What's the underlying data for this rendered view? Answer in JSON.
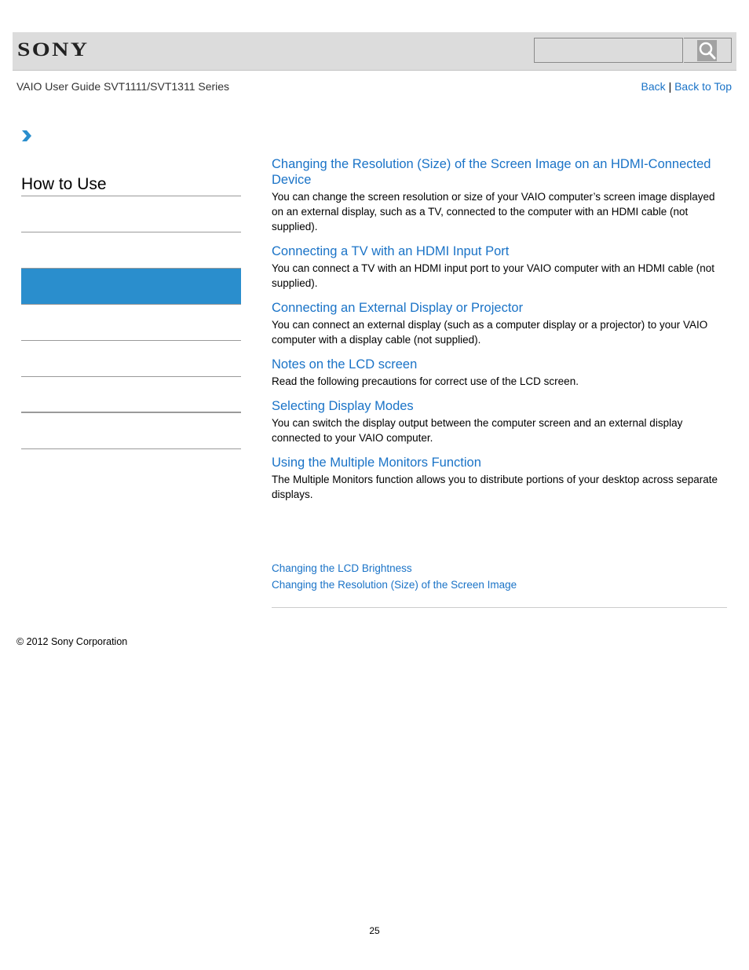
{
  "header": {
    "logo": "SONY",
    "search": {
      "placeholder": "",
      "value": "",
      "button_icon": "search-icon"
    }
  },
  "subheader": {
    "guide_title": "VAIO User Guide SVT1111/SVT1311 Series",
    "back_label": "Back",
    "separator": "|",
    "back_to_top_label": "Back to Top"
  },
  "breadcrumb": {
    "icon": "chevron-right-icon"
  },
  "sidebar": {
    "title": "How to Use",
    "items": [
      {
        "label": "",
        "active": false
      },
      {
        "label": "",
        "active": false
      },
      {
        "label": "",
        "active": true
      },
      {
        "label": "",
        "active": false
      },
      {
        "label": "",
        "active": false
      },
      {
        "label": "",
        "active": false
      },
      {
        "label": "",
        "active": false
      },
      {
        "label": "",
        "active": false
      }
    ]
  },
  "entries": [
    {
      "title": "Changing the Resolution (Size) of the Screen Image on an HDMI-Connected Device",
      "description": "You can change the screen resolution or size of your VAIO computer’s screen image displayed on an external display, such as a TV, connected to the computer with an HDMI cable (not supplied)."
    },
    {
      "title": "Connecting a TV with an HDMI Input Port",
      "description": "You can connect a TV with an HDMI input port to your VAIO computer with an HDMI cable (not supplied)."
    },
    {
      "title": "Connecting an External Display or Projector",
      "description": "You can connect an external display (such as a computer display or a projector) to your VAIO computer with a display cable (not supplied)."
    },
    {
      "title": "Notes on the LCD screen",
      "description": "Read the following precautions for correct use of the LCD screen."
    },
    {
      "title": "Selecting Display Modes",
      "description": "You can switch the display output between the computer screen and an external display connected to your VAIO computer."
    },
    {
      "title": "Using the Multiple Monitors Function",
      "description": "The Multiple Monitors function allows you to distribute portions of your desktop across separate displays."
    }
  ],
  "related_links": [
    "Changing the LCD Brightness",
    "Changing the Resolution (Size) of the Screen Image"
  ],
  "footer": {
    "copyright": "© 2012 Sony Corporation",
    "page_number": "25"
  },
  "colors": {
    "link": "#1a73c7",
    "active_item": "#2a8ecd",
    "header_bg": "#dcdcdc"
  }
}
